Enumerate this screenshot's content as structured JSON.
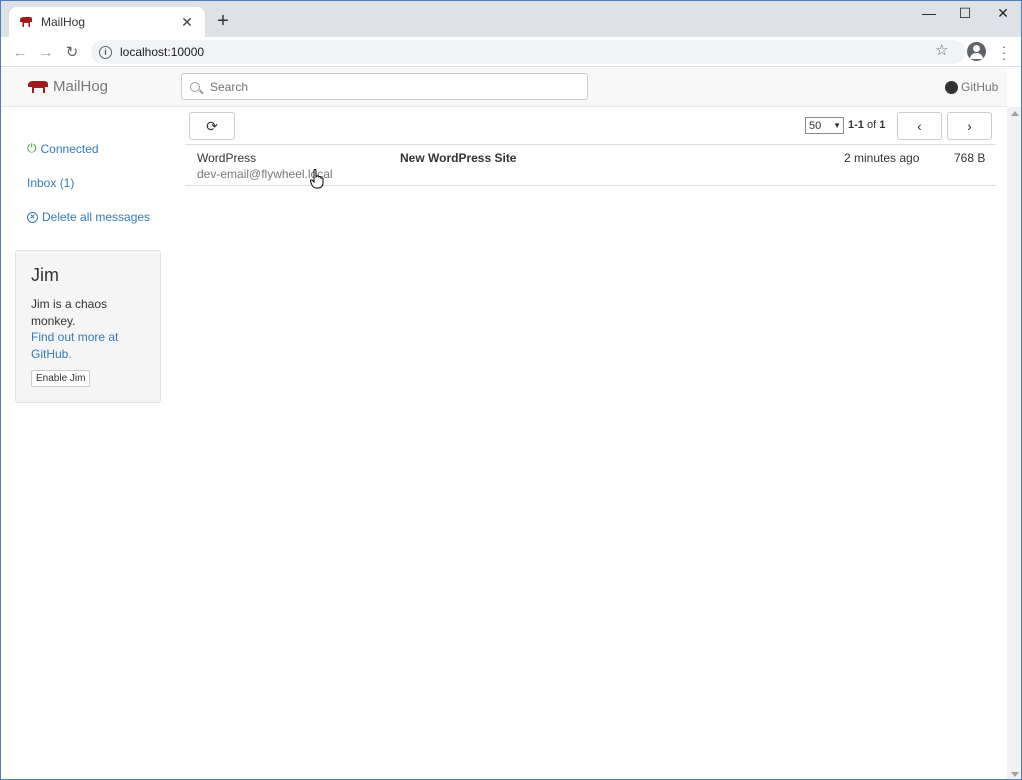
{
  "browser": {
    "tab_title": "MailHog",
    "tab_close": "✕",
    "new_tab": "+",
    "url": "localhost:10000",
    "window_controls": {
      "minimize": "—",
      "maximize": "☐",
      "close": "✕"
    },
    "icons": {
      "favicon": "pig-icon",
      "back": "arrow-left-icon",
      "forward": "arrow-right-icon",
      "reload": "reload-icon",
      "info": "info-icon",
      "bookmark": "star-icon",
      "profile": "account-icon",
      "menu": "more-vert-icon"
    }
  },
  "app": {
    "brand": "MailHog",
    "search_placeholder": "Search",
    "github_label": "GitHub",
    "colors": {
      "link": "#337ab7",
      "connected": "#3c9a3c",
      "brand_pig": "#a01c1c"
    },
    "sidebar": {
      "connected_label": "Connected",
      "inbox_label": "Inbox (1)",
      "delete_label": "Delete all messages"
    },
    "jim": {
      "title": "Jim",
      "text": "Jim is a chaos monkey.",
      "link1": "Find out more at",
      "link2": "GitHub.",
      "button": "Enable Jim"
    },
    "toolbar": {
      "per_page": "50",
      "range": "1-1",
      "of": "of",
      "total": "1"
    },
    "messages": [
      {
        "from": "WordPress",
        "to": "dev-email@flywheel.local",
        "subject": "New WordPress Site",
        "time": "2 minutes ago",
        "size": "768 B"
      }
    ]
  }
}
